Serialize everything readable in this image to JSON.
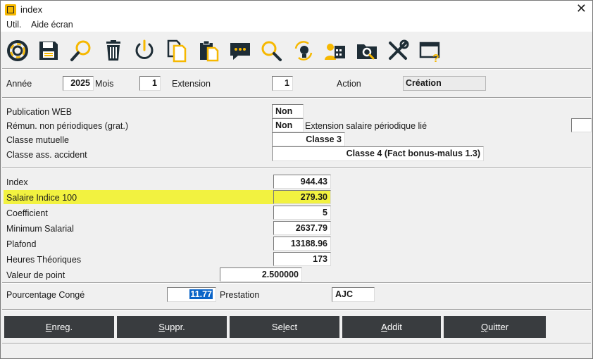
{
  "window": {
    "title": "index",
    "close_glyph": "✕"
  },
  "menu": [
    {
      "label": "Util."
    },
    {
      "label": "Aide écran"
    }
  ],
  "toolbar": [
    {
      "icon": "lifebuoy-icon"
    },
    {
      "icon": "save-icon"
    },
    {
      "icon": "search-icon"
    },
    {
      "icon": "trash-icon"
    },
    {
      "icon": "power-icon"
    },
    {
      "icon": "copy-icon"
    },
    {
      "icon": "paste-icon"
    },
    {
      "icon": "comment-icon"
    },
    {
      "icon": "zoom-icon"
    },
    {
      "icon": "refresh-idea-icon"
    },
    {
      "icon": "user-calendar-icon"
    },
    {
      "icon": "folder-search-icon"
    },
    {
      "icon": "tools-icon"
    },
    {
      "icon": "window-help-icon"
    }
  ],
  "header": {
    "annee_label": "Année",
    "annee_value": "2025",
    "mois_label": "Mois",
    "mois_value": "1",
    "extension_label": "Extension",
    "extension_value": "1",
    "action_label": "Action",
    "action_value": "Création"
  },
  "section2": {
    "publication_label": "Publication WEB",
    "publication_value": "Non",
    "remun_label": "Rémun. non périodiques (grat.)",
    "remun_value": "Non",
    "ext_salaire_label": "Extension salaire périodique lié",
    "ext_salaire_value": "",
    "classe_mutuelle_label": "Classe mutuelle",
    "classe_mutuelle_value": "Classe 3",
    "classe_acc_label": "Classe ass. accident",
    "classe_acc_value": "Classe 4 (Fact bonus-malus 1.3)"
  },
  "section3": {
    "index_label": "Index",
    "index_value": "944.43",
    "salaire_label": "Salaire Indice 100",
    "salaire_value": "279.30",
    "coef_label": "Coefficient",
    "coef_value": "5",
    "min_label": "Minimum Salarial",
    "min_value": "2637.79",
    "plafond_label": "Plafond",
    "plafond_value": "13188.96",
    "heures_label": "Heures Théoriques",
    "heures_value": "173",
    "point_label": "Valeur de point",
    "point_value": "2.500000"
  },
  "section4": {
    "conge_label": "Pourcentage Congé",
    "conge_value": "11.77",
    "prestation_label": "Prestation",
    "prestation_value": "AJC"
  },
  "buttons": [
    {
      "accel": "E",
      "rest": "nreg."
    },
    {
      "accel": "S",
      "rest": "uppr."
    },
    {
      "pre": "Se",
      "accel": "l",
      "rest": "ect"
    },
    {
      "accel": "A",
      "rest": "ddit"
    },
    {
      "accel": "Q",
      "rest": "uitter"
    }
  ],
  "colors": {
    "highlight": "#f2f240",
    "button_bg": "#393c3f",
    "selection": "#0a64c8"
  }
}
